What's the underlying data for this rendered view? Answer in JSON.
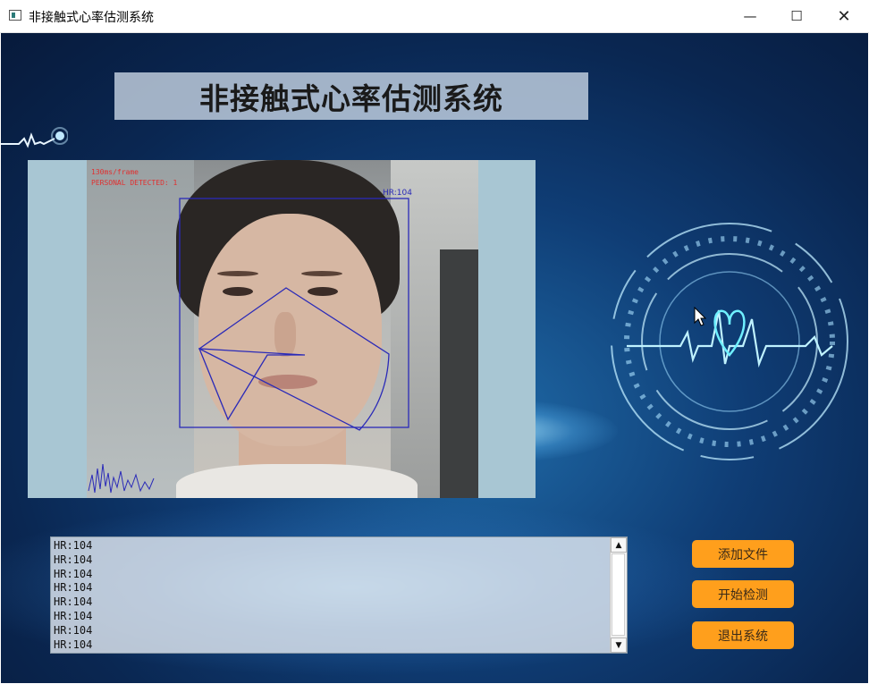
{
  "window": {
    "title": "非接触式心率估测系统",
    "controls": {
      "minimize": "—",
      "maximize": "☐",
      "close": "✕"
    }
  },
  "header": {
    "title": "非接触式心率估测系统"
  },
  "video": {
    "fps_text": "130ms/frame",
    "detect_text": "PERSONAL DETECTED: 1",
    "hr_label": "HR:104"
  },
  "log": {
    "lines": [
      "HR:104",
      "HR:104",
      "HR:104",
      "HR:104",
      "HR:104",
      "HR:104",
      "HR:104",
      "HR:104"
    ],
    "scroll_up": "▲",
    "scroll_down": "▼"
  },
  "buttons": {
    "add_file": "添加文件",
    "start_detect": "开始检测",
    "exit_system": "退出系统"
  },
  "colors": {
    "accent_button": "#ff9f1c",
    "overlay_red": "#e03030",
    "overlay_blue": "#2a2ab8",
    "background": "#0f3d75"
  }
}
